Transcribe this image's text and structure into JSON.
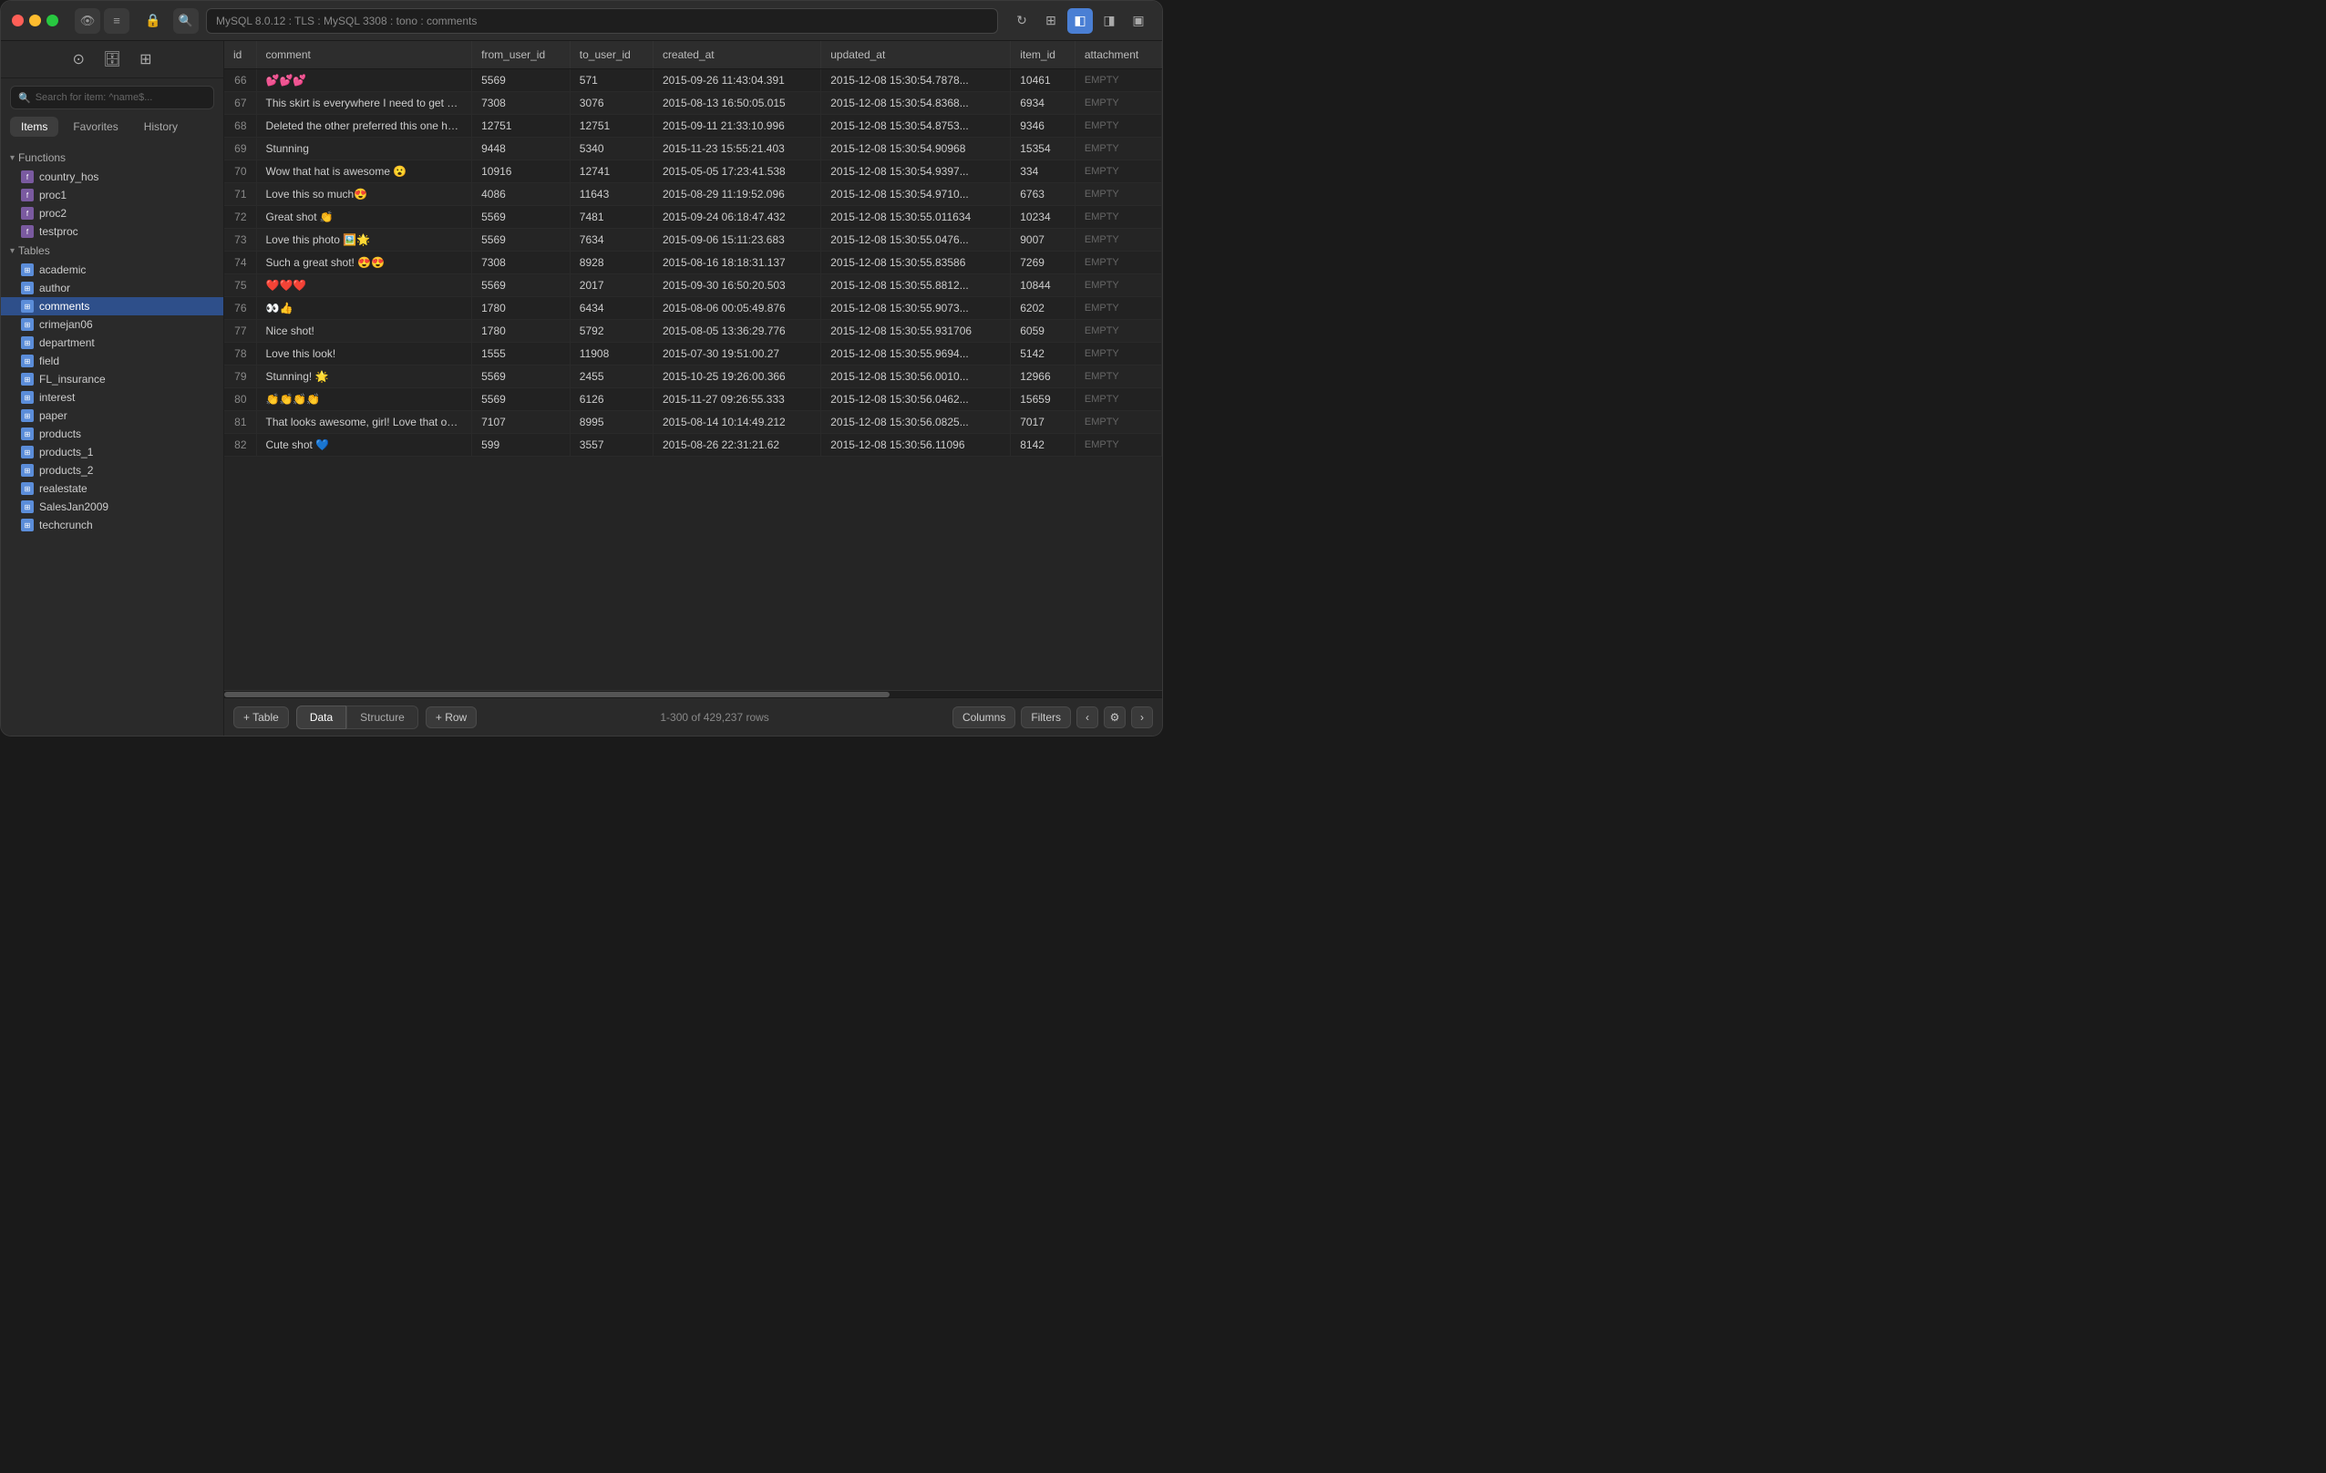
{
  "titlebar": {
    "search_text": "MySQL 8.0.12 : TLS : MySQL 3308 : tono : comments",
    "search_placeholder": "MySQL 8.0.12 : TLS : MySQL 3308 : tono : comments"
  },
  "sidebar": {
    "search_placeholder": "Search for item: ^name$...",
    "tabs": [
      "Items",
      "Favorites",
      "History"
    ],
    "active_tab": "Items",
    "sections": {
      "functions": {
        "label": "Functions",
        "items": [
          "country_hos",
          "proc1",
          "proc2",
          "testproc"
        ]
      },
      "tables": {
        "label": "Tables",
        "items": [
          "academic",
          "author",
          "comments",
          "crimejan06",
          "department",
          "field",
          "FL_insurance",
          "interest",
          "paper",
          "products",
          "products_1",
          "products_2",
          "realestate",
          "SalesJan2009",
          "techcrunch"
        ]
      }
    }
  },
  "table": {
    "columns": [
      "id",
      "comment",
      "from_user_id",
      "to_user_id",
      "created_at",
      "updated_at",
      "item_id",
      "attachment"
    ],
    "rows": [
      {
        "id": "66",
        "comment": "💕💕💕",
        "from_user_id": "5569",
        "to_user_id": "571",
        "created_at": "2015-09-26 11:43:04.391",
        "updated_at": "2015-12-08 15:30:54.7878...",
        "item_id": "10461",
        "attachment": "EMPTY"
      },
      {
        "id": "67",
        "comment": "This skirt is everywhere I need to get my hands on it!...",
        "from_user_id": "7308",
        "to_user_id": "3076",
        "created_at": "2015-08-13 16:50:05.015",
        "updated_at": "2015-12-08 15:30:54.8368...",
        "item_id": "6934",
        "attachment": "EMPTY"
      },
      {
        "id": "68",
        "comment": "Deleted the other preferred this one haha😀",
        "from_user_id": "12751",
        "to_user_id": "12751",
        "created_at": "2015-09-11 21:33:10.996",
        "updated_at": "2015-12-08 15:30:54.8753...",
        "item_id": "9346",
        "attachment": "EMPTY"
      },
      {
        "id": "69",
        "comment": "Stunning",
        "from_user_id": "9448",
        "to_user_id": "5340",
        "created_at": "2015-11-23 15:55:21.403",
        "updated_at": "2015-12-08 15:30:54.90968",
        "item_id": "15354",
        "attachment": "EMPTY"
      },
      {
        "id": "70",
        "comment": "Wow that hat is awesome 😮",
        "from_user_id": "10916",
        "to_user_id": "12741",
        "created_at": "2015-05-05 17:23:41.538",
        "updated_at": "2015-12-08 15:30:54.9397...",
        "item_id": "334",
        "attachment": "EMPTY"
      },
      {
        "id": "71",
        "comment": "Love this so much😍",
        "from_user_id": "4086",
        "to_user_id": "11643",
        "created_at": "2015-08-29 11:19:52.096",
        "updated_at": "2015-12-08 15:30:54.9710...",
        "item_id": "6763",
        "attachment": "EMPTY"
      },
      {
        "id": "72",
        "comment": "Great shot 👏",
        "from_user_id": "5569",
        "to_user_id": "7481",
        "created_at": "2015-09-24 06:18:47.432",
        "updated_at": "2015-12-08 15:30:55.011634",
        "item_id": "10234",
        "attachment": "EMPTY"
      },
      {
        "id": "73",
        "comment": "Love this photo 🖼️🌟",
        "from_user_id": "5569",
        "to_user_id": "7634",
        "created_at": "2015-09-06 15:11:23.683",
        "updated_at": "2015-12-08 15:30:55.0476...",
        "item_id": "9007",
        "attachment": "EMPTY"
      },
      {
        "id": "74",
        "comment": "Such a great shot! 😍😍",
        "from_user_id": "7308",
        "to_user_id": "8928",
        "created_at": "2015-08-16 18:18:31.137",
        "updated_at": "2015-12-08 15:30:55.83586",
        "item_id": "7269",
        "attachment": "EMPTY"
      },
      {
        "id": "75",
        "comment": "❤️❤️❤️",
        "from_user_id": "5569",
        "to_user_id": "2017",
        "created_at": "2015-09-30 16:50:20.503",
        "updated_at": "2015-12-08 15:30:55.8812...",
        "item_id": "10844",
        "attachment": "EMPTY"
      },
      {
        "id": "76",
        "comment": "👀👍",
        "from_user_id": "1780",
        "to_user_id": "6434",
        "created_at": "2015-08-06 00:05:49.876",
        "updated_at": "2015-12-08 15:30:55.9073...",
        "item_id": "6202",
        "attachment": "EMPTY"
      },
      {
        "id": "77",
        "comment": "Nice shot!",
        "from_user_id": "1780",
        "to_user_id": "5792",
        "created_at": "2015-08-05 13:36:29.776",
        "updated_at": "2015-12-08 15:30:55.931706",
        "item_id": "6059",
        "attachment": "EMPTY"
      },
      {
        "id": "78",
        "comment": "Love this look!",
        "from_user_id": "1555",
        "to_user_id": "11908",
        "created_at": "2015-07-30 19:51:00.27",
        "updated_at": "2015-12-08 15:30:55.9694...",
        "item_id": "5142",
        "attachment": "EMPTY"
      },
      {
        "id": "79",
        "comment": "Stunning! 🌟",
        "from_user_id": "5569",
        "to_user_id": "2455",
        "created_at": "2015-10-25 19:26:00.366",
        "updated_at": "2015-12-08 15:30:56.0010...",
        "item_id": "12966",
        "attachment": "EMPTY"
      },
      {
        "id": "80",
        "comment": "👏👏👏👏",
        "from_user_id": "5569",
        "to_user_id": "6126",
        "created_at": "2015-11-27 09:26:55.333",
        "updated_at": "2015-12-08 15:30:56.0462...",
        "item_id": "15659",
        "attachment": "EMPTY"
      },
      {
        "id": "81",
        "comment": "That looks awesome, girl! Love that outfit! It's your o...",
        "from_user_id": "7107",
        "to_user_id": "8995",
        "created_at": "2015-08-14 10:14:49.212",
        "updated_at": "2015-12-08 15:30:56.0825...",
        "item_id": "7017",
        "attachment": "EMPTY"
      },
      {
        "id": "82",
        "comment": "Cute shot 💙",
        "from_user_id": "599",
        "to_user_id": "3557",
        "created_at": "2015-08-26 22:31:21.62",
        "updated_at": "2015-12-08 15:30:56.11096",
        "item_id": "8142",
        "attachment": "EMPTY"
      }
    ]
  },
  "bottom": {
    "add_table_label": "+ Table",
    "tab_data": "Data",
    "tab_structure": "Structure",
    "add_row_label": "+ Row",
    "row_count": "1-300 of 429,237 rows",
    "columns_label": "Columns",
    "filters_label": "Filters"
  },
  "icons": {
    "search": "🔍",
    "refresh": "↻",
    "grid": "⊞",
    "panel_left": "◧",
    "panel_right": "◨",
    "panel_both": "▣",
    "lock": "🔒",
    "eye": "👁",
    "list": "≡",
    "db": "🗄",
    "table_small": "⊞",
    "chevron_down": "▾",
    "chevron_right": "▸",
    "gear": "⚙",
    "prev": "‹",
    "next": "›"
  }
}
